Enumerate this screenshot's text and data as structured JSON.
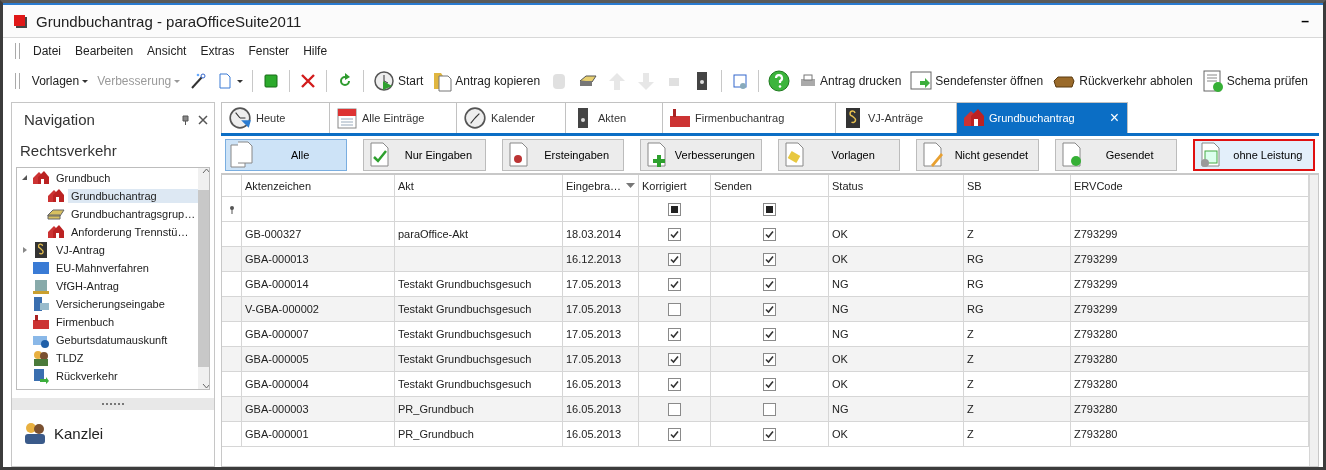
{
  "window": {
    "title": "Grundbuchantrag - paraOfficeSuite2011",
    "minimize": "–"
  },
  "menu": [
    "Datei",
    "Bearbeiten",
    "Ansicht",
    "Extras",
    "Fenster",
    "Hilfe"
  ],
  "toolbar": [
    {
      "kind": "dropdown",
      "label": "Vorlagen",
      "disabled": false
    },
    {
      "kind": "dropdown",
      "label": "Verbesserung",
      "disabled": true
    },
    {
      "kind": "icon",
      "disabled": false
    },
    {
      "kind": "icondrop",
      "disabled": false
    },
    {
      "kind": "separator"
    },
    {
      "kind": "icon",
      "disabled": false
    },
    {
      "kind": "separator"
    },
    {
      "kind": "icon",
      "disabled": false
    },
    {
      "kind": "separator"
    },
    {
      "kind": "icon",
      "disabled": false
    },
    {
      "kind": "separator"
    },
    {
      "kind": "button",
      "label": "Start",
      "disabled": false
    },
    {
      "kind": "button",
      "label": "Antrag kopieren",
      "disabled": false
    },
    {
      "kind": "icon",
      "disabled": true
    },
    {
      "kind": "icon",
      "disabled": false
    },
    {
      "kind": "icon",
      "disabled": true
    },
    {
      "kind": "icon",
      "disabled": true
    },
    {
      "kind": "icon",
      "disabled": true
    },
    {
      "kind": "icon",
      "disabled": false
    },
    {
      "kind": "separator"
    },
    {
      "kind": "icon",
      "disabled": false
    },
    {
      "kind": "separator"
    },
    {
      "kind": "icon",
      "disabled": false
    },
    {
      "kind": "button",
      "label": "Antrag drucken",
      "disabled": false
    },
    {
      "kind": "button",
      "label": "Sendefenster öffnen",
      "disabled": false
    },
    {
      "kind": "button",
      "label": "Rückverkehr abholen",
      "disabled": false
    },
    {
      "kind": "button",
      "label": "Schema prüfen",
      "disabled": false
    }
  ],
  "navigation": {
    "title": "Navigation",
    "section": "Rechtsverkehr",
    "tree": [
      {
        "label": "Grundbuch",
        "expanded": true,
        "selected": false,
        "children": [
          {
            "label": "Grundbuchantrag",
            "selected": true
          },
          {
            "label": "Grundbuchantragsgrup…",
            "selected": false
          },
          {
            "label": "Anforderung Trennstü…",
            "selected": false
          }
        ]
      },
      {
        "label": "VJ-Antrag",
        "expanded": false,
        "selected": false
      },
      {
        "label": "EU-Mahnverfahren",
        "selected": false
      },
      {
        "label": "VfGH-Antrag",
        "selected": false
      },
      {
        "label": "Versicherungseingabe",
        "selected": false
      },
      {
        "label": "Firmenbuch",
        "selected": false
      },
      {
        "label": "Geburtsdatumauskunft",
        "selected": false
      },
      {
        "label": "TLDZ",
        "selected": false
      },
      {
        "label": "Rückverkehr",
        "selected": false
      }
    ],
    "groups": [
      "Kanzlei"
    ]
  },
  "tabs": [
    {
      "label": "Heute",
      "selected": false
    },
    {
      "label": "Alle Einträge",
      "selected": false
    },
    {
      "label": "Kalender",
      "selected": false
    },
    {
      "label": "Akten",
      "selected": false
    },
    {
      "label": "Firmenbuchantrag",
      "selected": false
    },
    {
      "label": "VJ-Anträge",
      "selected": false
    },
    {
      "label": "Grundbuchantrag",
      "selected": true,
      "close": "×"
    }
  ],
  "filters": [
    {
      "label": "Alle",
      "selected": true,
      "hovered": false
    },
    {
      "label": "Nur Eingaben",
      "selected": false,
      "hovered": false
    },
    {
      "label": "Ersteingaben",
      "selected": false,
      "hovered": false
    },
    {
      "label": "Verbesserungen",
      "selected": false,
      "hovered": false
    },
    {
      "label": "Vorlagen",
      "selected": false,
      "hovered": false
    },
    {
      "label": "Nicht gesendet",
      "selected": false,
      "hovered": false
    },
    {
      "label": "Gesendet",
      "selected": false,
      "hovered": false
    },
    {
      "label": "ohne Leistung",
      "selected": false,
      "hovered": true
    }
  ],
  "table": {
    "columns": [
      {
        "label": "Aktenzeichen",
        "sorted": false
      },
      {
        "label": "Akt",
        "sorted": false
      },
      {
        "label": "Eingebra…",
        "sorted": true
      },
      {
        "label": "Korrigiert",
        "sorted": false
      },
      {
        "label": "Senden",
        "sorted": false
      },
      {
        "label": "Status",
        "sorted": false
      },
      {
        "label": "SB",
        "sorted": false
      },
      {
        "label": "ERVCode",
        "sorted": false
      }
    ],
    "filter_row": {
      "korrigiert": {
        "indeterminate": true
      },
      "senden": {
        "indeterminate": true
      }
    },
    "rows": [
      {
        "aktenzeichen": "GB-000327",
        "akt": "paraOffice-Akt",
        "date": "18.03.2014",
        "korrigiert": true,
        "senden": true,
        "status": "OK",
        "sb": "Z",
        "erv": "Z793299"
      },
      {
        "aktenzeichen": "GBA-000013",
        "akt": "",
        "date": "16.12.2013",
        "korrigiert": true,
        "senden": true,
        "status": "OK",
        "sb": "RG",
        "erv": "Z793299"
      },
      {
        "aktenzeichen": "GBA-000014",
        "akt": "Testakt Grundbuchsgesuch",
        "date": "17.05.2013",
        "korrigiert": true,
        "senden": true,
        "status": "NG",
        "sb": "RG",
        "erv": "Z793299"
      },
      {
        "aktenzeichen": "V-GBA-000002",
        "akt": "Testakt Grundbuchsgesuch",
        "date": "17.05.2013",
        "korrigiert": false,
        "senden": true,
        "status": "NG",
        "sb": "RG",
        "erv": "Z793299"
      },
      {
        "aktenzeichen": "GBA-000007",
        "akt": "Testakt Grundbuchsgesuch",
        "date": "17.05.2013",
        "korrigiert": true,
        "senden": true,
        "status": "NG",
        "sb": "Z",
        "erv": "Z793280"
      },
      {
        "aktenzeichen": "GBA-000005",
        "akt": "Testakt Grundbuchsgesuch",
        "date": "17.05.2013",
        "korrigiert": true,
        "senden": true,
        "status": "OK",
        "sb": "Z",
        "erv": "Z793280"
      },
      {
        "aktenzeichen": "GBA-000004",
        "akt": "Testakt Grundbuchsgesuch",
        "date": "16.05.2013",
        "korrigiert": true,
        "senden": true,
        "status": "OK",
        "sb": "Z",
        "erv": "Z793280"
      },
      {
        "aktenzeichen": "GBA-000003",
        "akt": "PR_Grundbuch",
        "date": "16.05.2013",
        "korrigiert": false,
        "senden": false,
        "status": "NG",
        "sb": "Z",
        "erv": "Z793280"
      },
      {
        "aktenzeichen": "GBA-000001",
        "akt": "PR_Grundbuch",
        "date": "16.05.2013",
        "korrigiert": true,
        "senden": true,
        "status": "OK",
        "sb": "Z",
        "erv": "Z793280"
      }
    ]
  }
}
